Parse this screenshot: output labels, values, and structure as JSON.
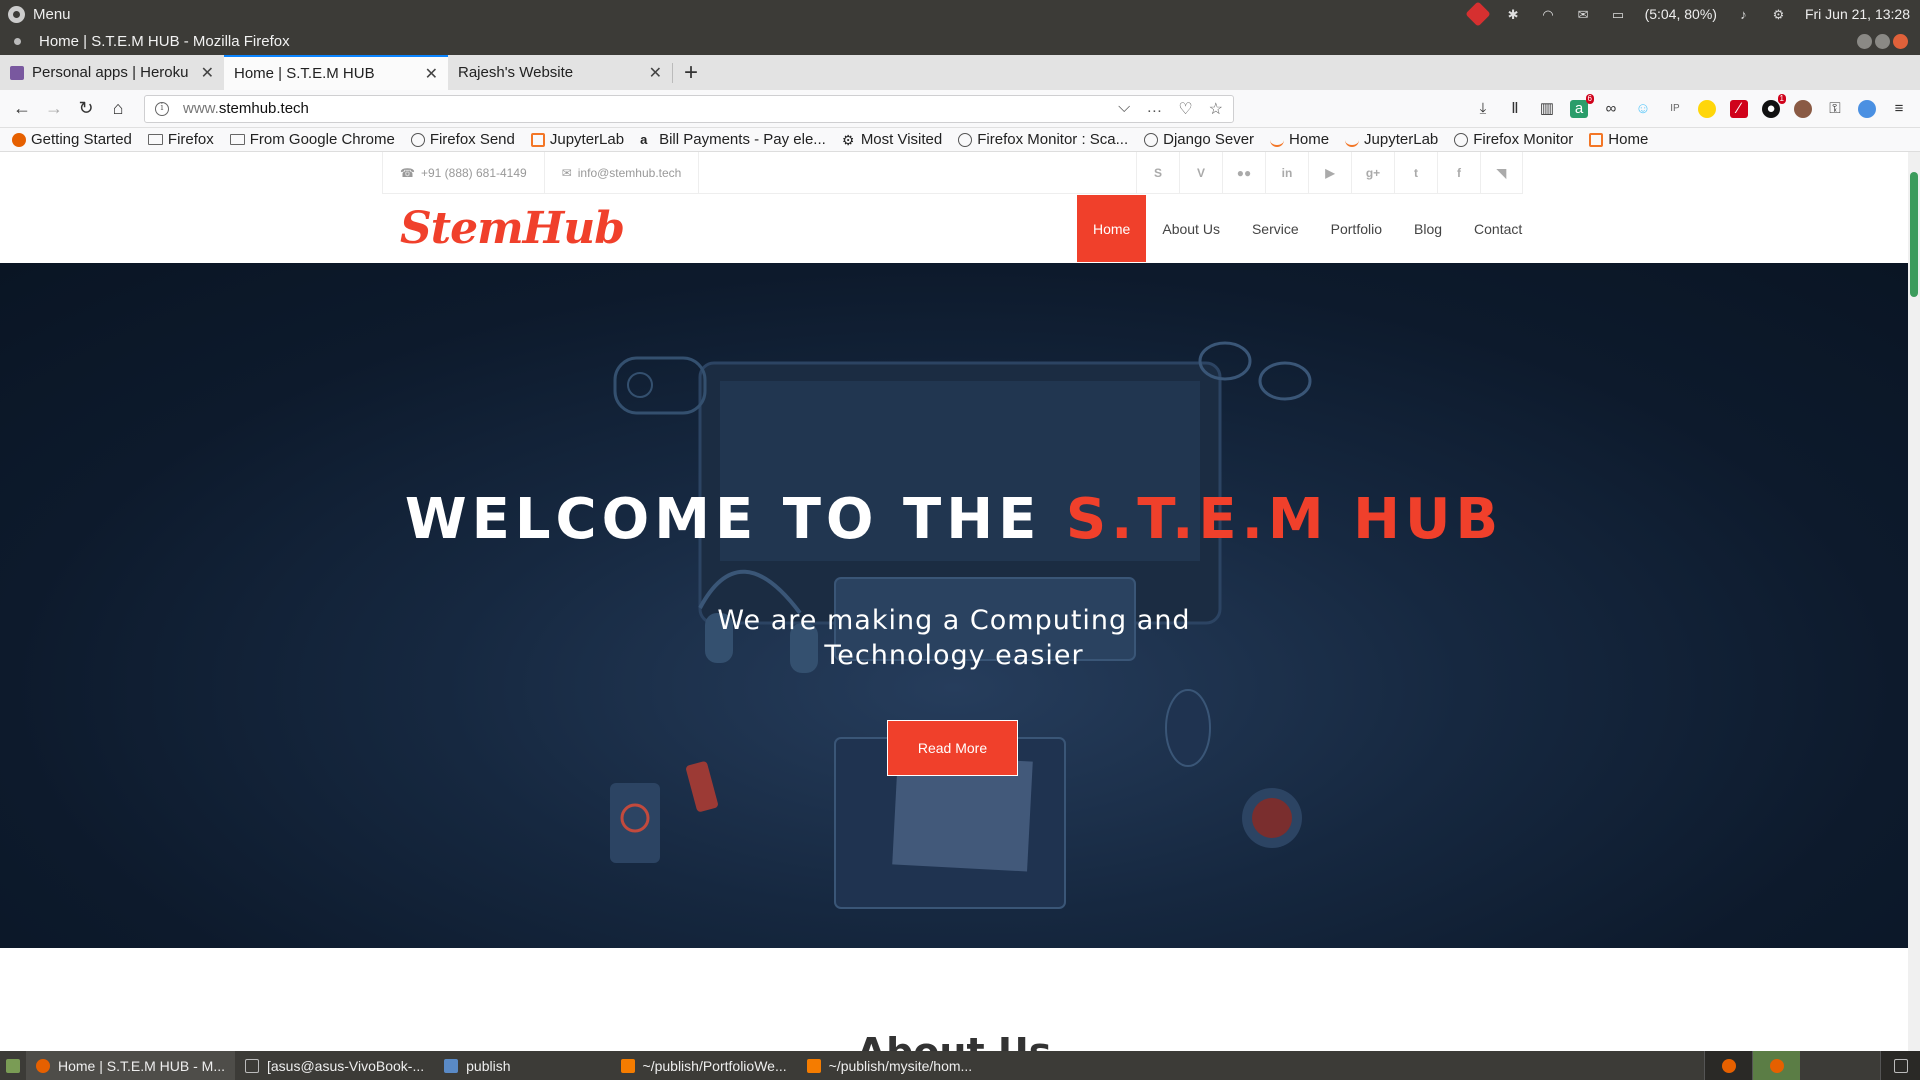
{
  "os_panel": {
    "menu_label": "Menu",
    "battery": "(5:04, 80%)",
    "clock": "Fri Jun 21, 13:28",
    "tray_icons": [
      "red-diamond-icon",
      "bluetooth-icon",
      "wifi-icon",
      "mail-icon",
      "battery-icon",
      "volume-icon",
      "settings-icon"
    ]
  },
  "window": {
    "title": "Home | S.T.E.M HUB - Mozilla Firefox"
  },
  "tabs": [
    {
      "label": "Personal apps | Heroku",
      "favicon_color": "#79589f"
    },
    {
      "label": "Home | S.T.E.M HUB",
      "favicon_color": ""
    },
    {
      "label": "Rajesh's Website",
      "favicon_color": ""
    }
  ],
  "nav": {
    "url_prefix": "www.",
    "url_host": "stemhub.tech",
    "toolbar_icons": [
      "download-icon",
      "library-icon",
      "sidebar-icon",
      "extension-badge-icon",
      "glasses-icon",
      "smiley-icon",
      "ip-icon",
      "bulb-icon",
      "red-extension-icon",
      "notification-icon",
      "avatar-icon",
      "key-icon",
      "shield-icon",
      "hamburger-menu-icon"
    ],
    "extension_badge_1": "6",
    "extension_badge_2": "1"
  },
  "bookmarks": [
    {
      "label": "Getting Started",
      "icon": "firefox"
    },
    {
      "label": "Firefox",
      "icon": "folder"
    },
    {
      "label": "From Google Chrome",
      "icon": "folder"
    },
    {
      "label": "Firefox Send",
      "icon": "globe"
    },
    {
      "label": "JupyterLab",
      "icon": "orange"
    },
    {
      "label": "Bill Payments - Pay ele...",
      "icon": "amazon"
    },
    {
      "label": "Most Visited",
      "icon": "gear"
    },
    {
      "label": "Firefox Monitor : Sca...",
      "icon": "globe"
    },
    {
      "label": "Django Sever",
      "icon": "globe"
    },
    {
      "label": "Home",
      "icon": "orange-arc"
    },
    {
      "label": "JupyterLab",
      "icon": "orange-arc"
    },
    {
      "label": "Firefox Monitor",
      "icon": "globe"
    },
    {
      "label": "Home",
      "icon": "orange"
    }
  ],
  "site": {
    "phone": "+91 (888) 681-4149",
    "email": "info@stemhub.tech",
    "social": [
      "skype-icon",
      "vimeo-icon",
      "flickr-icon",
      "linkedin-icon",
      "youtube-icon",
      "google-plus-icon",
      "twitter-icon",
      "facebook-icon",
      "rss-icon"
    ],
    "logo": "StemHub",
    "nav": [
      "Home",
      "About Us",
      "Service",
      "Portfolio",
      "Blog",
      "Contact"
    ],
    "hero": {
      "title_part1": "WELCOME TO THE ",
      "title_part2": "S.T.E.M HUB",
      "subtitle_line1": "We are making a Computing and",
      "subtitle_line2": "Technology easier",
      "button": "Read More"
    },
    "about_heading": "About Us",
    "accent_color": "#f0402b"
  },
  "taskbar": [
    {
      "label": "Home | S.T.E.M HUB - M...",
      "icon": "firefox"
    },
    {
      "label": "[asus@asus-VivoBook-...",
      "icon": "terminal"
    },
    {
      "label": "publish",
      "icon": "folder"
    },
    {
      "label": "~/publish/PortfolioWe...",
      "icon": "sublime"
    },
    {
      "label": "~/publish/mysite/hom...",
      "icon": "sublime"
    }
  ]
}
